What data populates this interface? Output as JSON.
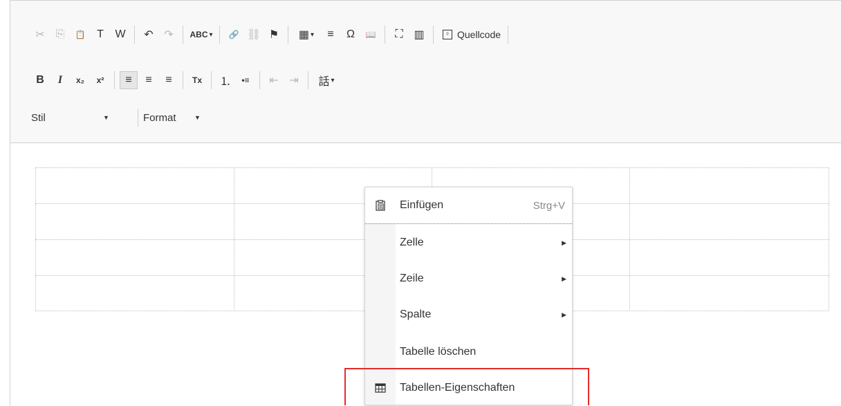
{
  "toolbar": {
    "row1": [
      {
        "icon": "cut-icon",
        "glyph": "✂",
        "disabled": true
      },
      {
        "icon": "copy-icon",
        "glyph": "⎘",
        "disabled": true
      },
      {
        "icon": "paste-icon",
        "glyph": "📋",
        "disabled": false
      },
      {
        "icon": "paste-text-icon",
        "glyph": "T",
        "disabled": false
      },
      {
        "icon": "paste-word-icon",
        "glyph": "W",
        "disabled": false
      },
      {
        "sep": true
      },
      {
        "icon": "undo-icon",
        "glyph": "↶",
        "disabled": false
      },
      {
        "icon": "redo-icon",
        "glyph": "↷",
        "disabled": true
      },
      {
        "sep": true
      },
      {
        "icon": "spellcheck-icon",
        "glyph": "ABC",
        "disabled": false,
        "dropdown": true
      },
      {
        "sep": true
      },
      {
        "icon": "link-icon",
        "glyph": "🔗",
        "disabled": false
      },
      {
        "icon": "unlink-icon",
        "glyph": "⛓",
        "disabled": true
      },
      {
        "icon": "anchor-flag-icon",
        "glyph": "⚑",
        "disabled": false
      },
      {
        "sep": true
      },
      {
        "icon": "table-icon",
        "glyph": "▦",
        "disabled": false,
        "dropdown": true
      },
      {
        "icon": "horizontal-line-icon",
        "glyph": "≡",
        "disabled": false
      },
      {
        "icon": "special-char-icon",
        "glyph": "Ω",
        "disabled": false
      },
      {
        "icon": "book-icon",
        "glyph": "📖",
        "disabled": false
      },
      {
        "sep": true
      },
      {
        "icon": "maximize-icon",
        "glyph": "⛶",
        "disabled": false
      },
      {
        "icon": "show-blocks-icon",
        "glyph": "▥",
        "disabled": false
      },
      {
        "sep": true
      }
    ],
    "source_label": "Quellcode",
    "row2": [
      {
        "icon": "bold-icon",
        "glyph": "B",
        "disabled": false
      },
      {
        "icon": "italic-icon",
        "glyph": "I",
        "disabled": false
      },
      {
        "icon": "subscript-icon",
        "glyph": "x₂",
        "disabled": false
      },
      {
        "icon": "superscript-icon",
        "glyph": "x²",
        "disabled": false
      },
      {
        "sep": true
      },
      {
        "icon": "align-left-icon",
        "glyph": "≡",
        "disabled": false,
        "active": true
      },
      {
        "icon": "align-center-icon",
        "glyph": "≡",
        "disabled": false
      },
      {
        "icon": "align-right-icon",
        "glyph": "≡",
        "disabled": false
      },
      {
        "sep": true
      },
      {
        "icon": "remove-format-icon",
        "glyph": "Tx",
        "disabled": false
      },
      {
        "sep": true
      },
      {
        "icon": "numbered-list-icon",
        "glyph": "⒈",
        "disabled": false
      },
      {
        "icon": "bulleted-list-icon",
        "glyph": "•≡",
        "disabled": false
      },
      {
        "sep": true
      },
      {
        "icon": "outdent-icon",
        "glyph": "⇤",
        "disabled": true
      },
      {
        "icon": "indent-icon",
        "glyph": "⇥",
        "disabled": true
      },
      {
        "sep": true
      },
      {
        "icon": "language-icon",
        "glyph": "話",
        "disabled": false,
        "dropdown": true
      }
    ],
    "style_label": "Stil",
    "format_label": "Format"
  },
  "context_menu": {
    "paste_label": "Einfügen",
    "paste_shortcut": "Strg+V",
    "cell_label": "Zelle",
    "row_label": "Zeile",
    "column_label": "Spalte",
    "delete_table_label": "Tabelle löschen",
    "table_properties_label": "Tabellen-Eigenschaften"
  },
  "colors": {
    "highlight": "#e42a2a",
    "toolbar_bg": "#f8f8f8"
  }
}
